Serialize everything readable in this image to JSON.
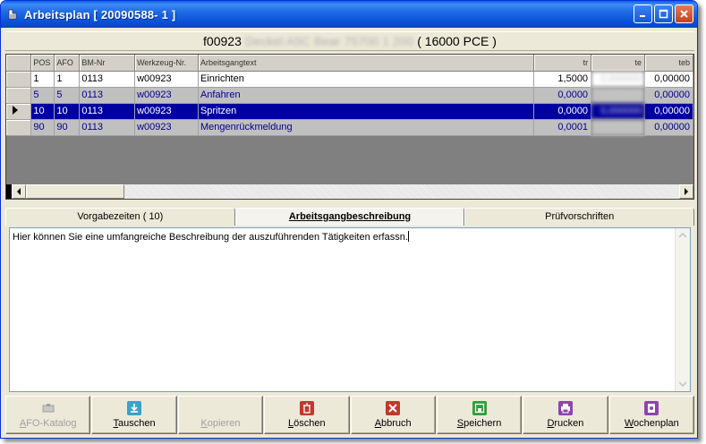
{
  "window": {
    "title": "Arbeitsplan  [ 20090588- 1 ]"
  },
  "header": {
    "code": "f00923",
    "blurred_name": "Deckel A5C Bear 75700 1 200",
    "quantity": "( 16000 PCE )"
  },
  "grid": {
    "columns": [
      "POS",
      "AFO",
      "BM-Nr",
      "Werkzeug-Nr.",
      "Arbeitsgangtext",
      "tr",
      "te",
      "teb"
    ],
    "rows": [
      {
        "pos": "1",
        "afo": "1",
        "bm": "0113",
        "wz": "w00923",
        "text": "Einrichten",
        "tr": "1,5000",
        "te": "0,000000",
        "teb": "0,00000"
      },
      {
        "pos": "5",
        "afo": "5",
        "bm": "0113",
        "wz": "w00923",
        "text": "Anfahren",
        "tr": "0,0000",
        "te": "0,000000",
        "teb": "0,00000"
      },
      {
        "pos": "10",
        "afo": "10",
        "bm": "0113",
        "wz": "w00923",
        "text": "Spritzen",
        "tr": "0,0000",
        "te": "0,000000",
        "teb": "0,00000"
      },
      {
        "pos": "90",
        "afo": "90",
        "bm": "0113",
        "wz": "w00923",
        "text": "Mengenrückmeldung",
        "tr": "0,0001",
        "te": "0,000000",
        "teb": "0,00000"
      }
    ]
  },
  "tabs": [
    {
      "label": "Vorgabezeiten ( 10)"
    },
    {
      "label": "Arbeitsgangbeschreibung"
    },
    {
      "label": "Prüfvorschriften"
    }
  ],
  "description": {
    "text": "Hier können Sie eine umfangreiche Beschreibung der auszuführenden Tätigkeiten erfassn."
  },
  "toolbar": {
    "katalog": {
      "pre": "",
      "u": "A",
      "post": "FO-Katalog"
    },
    "tauschen": {
      "pre": "",
      "u": "T",
      "post": "auschen"
    },
    "kopieren": {
      "pre": "",
      "u": "K",
      "post": "opieren"
    },
    "loeschen": {
      "pre": "",
      "u": "L",
      "post": "öschen"
    },
    "abbruch": {
      "pre": "",
      "u": "A",
      "post": "bbruch"
    },
    "speichern": {
      "pre": "",
      "u": "S",
      "post": "peichern"
    },
    "drucken": {
      "pre": "",
      "u": "D",
      "post": "rucken"
    },
    "wochenplan": {
      "pre": "",
      "u": "W",
      "post": "ochenplan"
    }
  },
  "colors": {
    "selection": "#0000a0",
    "gray_row": "#c0c0c0",
    "title_blue": "#0a4fd6"
  }
}
